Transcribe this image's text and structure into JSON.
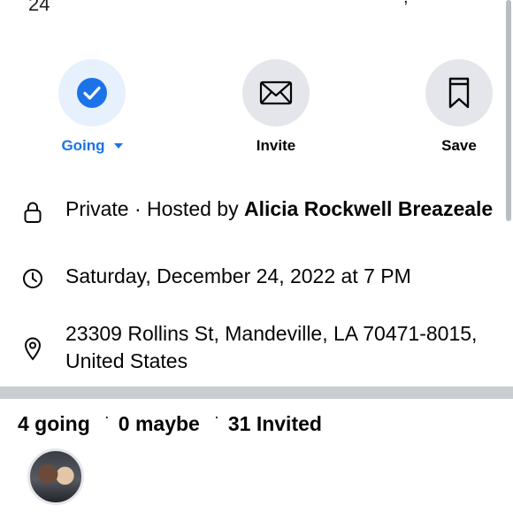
{
  "header": {
    "date_fragment": "24",
    "corner_fragment": ","
  },
  "actions": {
    "going_label": "Going",
    "invite_label": "Invite",
    "save_label": "Save",
    "accent_color": "#1a73e8"
  },
  "details": {
    "privacy_prefix": "Private · Hosted by ",
    "host_name": "Alicia Rockwell Breazeale",
    "datetime": "Saturday, December 24, 2022 at 7 PM",
    "address": "23309 Rollins St, Mandeville, LA 70471-8015, United States"
  },
  "attendance": {
    "going": "4 going",
    "maybe": "0 maybe",
    "invited": "31 Invited",
    "separator": "·"
  },
  "icons": {
    "going": "check-circle-icon",
    "invite": "envelope-icon",
    "save": "bookmark-icon",
    "privacy": "lock-icon",
    "time": "clock-icon",
    "location": "map-pin-icon"
  }
}
